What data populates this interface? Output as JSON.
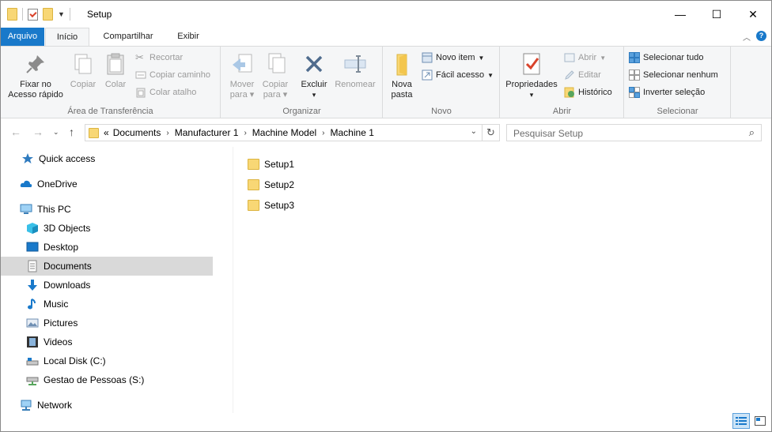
{
  "window": {
    "title": "Setup"
  },
  "window_controls": {
    "minimize": "—",
    "maximize": "☐",
    "close": "✕"
  },
  "tabs": {
    "file": "Arquivo",
    "home": "Início",
    "share": "Compartilhar",
    "view": "Exibir"
  },
  "ribbon": {
    "clipboard": {
      "label": "Área de Transferência",
      "pin": "Fixar no\nAcesso rápido",
      "copy": "Copiar",
      "paste": "Colar",
      "cut": "Recortar",
      "copy_path": "Copiar caminho",
      "paste_shortcut": "Colar atalho"
    },
    "organize": {
      "label": "Organizar",
      "move_to": "Mover",
      "move_to2": "para",
      "copy_to": "Copiar",
      "copy_to2": "para",
      "delete": "Excluir",
      "rename": "Renomear"
    },
    "new": {
      "label": "Novo",
      "new_folder": "Nova",
      "new_folder2": "pasta",
      "new_item": "Novo item",
      "easy_access": "Fácil acesso"
    },
    "open": {
      "label": "Abrir",
      "properties": "Propriedades",
      "open": "Abrir",
      "edit": "Editar",
      "history": "Histórico"
    },
    "select": {
      "label": "Selecionar",
      "select_all": "Selecionar tudo",
      "select_none": "Selecionar nenhum",
      "invert": "Inverter seleção"
    }
  },
  "address": {
    "overflow": "«",
    "crumbs": [
      "Documents",
      "Manufacturer 1",
      "Machine Model",
      "Machine 1"
    ]
  },
  "search": {
    "placeholder": "Pesquisar Setup"
  },
  "nav": {
    "items": [
      {
        "label": "Quick access",
        "icon": "star-icon"
      },
      {
        "label": "OneDrive",
        "icon": "cloud-icon"
      },
      {
        "label": "This PC",
        "icon": "computer-icon"
      },
      {
        "label": "3D Objects",
        "icon": "cube-icon"
      },
      {
        "label": "Desktop",
        "icon": "desktop-icon"
      },
      {
        "label": "Documents",
        "icon": "document-icon"
      },
      {
        "label": "Downloads",
        "icon": "download-arrow-icon"
      },
      {
        "label": "Music",
        "icon": "music-note-icon"
      },
      {
        "label": "Pictures",
        "icon": "picture-icon"
      },
      {
        "label": "Videos",
        "icon": "film-icon"
      },
      {
        "label": "Local Disk (C:)",
        "icon": "drive-icon"
      },
      {
        "label": "Gestao de Pessoas (S:)",
        "icon": "network-drive-icon"
      },
      {
        "label": "Network",
        "icon": "network-icon"
      }
    ],
    "selected": "Documents"
  },
  "files": [
    "Setup1",
    "Setup2",
    "Setup3"
  ],
  "colors": {
    "accent": "#1979ca",
    "folder": "#f8d775",
    "selection": "#d9d9d9"
  }
}
